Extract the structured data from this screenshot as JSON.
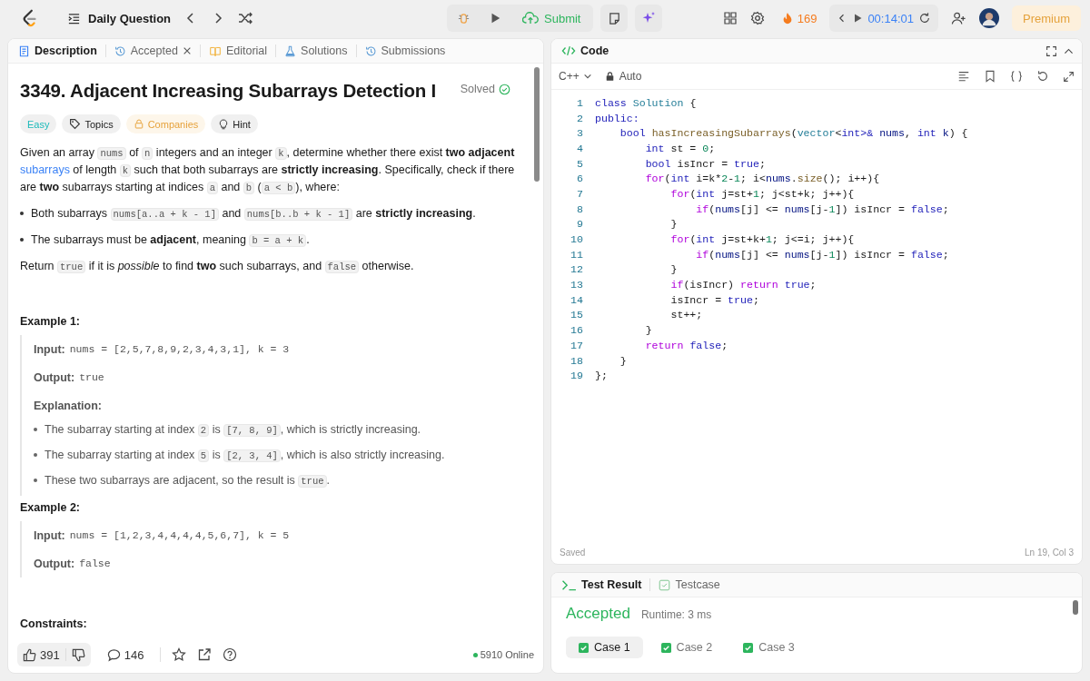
{
  "topbar": {
    "title": "Daily Question",
    "submit": "Submit",
    "streak": "169",
    "timer": "00:14:01",
    "premium": "Premium"
  },
  "left_tabs": [
    {
      "label": "Description",
      "selected": true,
      "kind": "description",
      "closable": false
    },
    {
      "label": "Accepted",
      "selected": false,
      "kind": "accepted",
      "closable": true
    },
    {
      "label": "Editorial",
      "selected": false,
      "kind": "editorial",
      "closable": false
    },
    {
      "label": "Solutions",
      "selected": false,
      "kind": "solutions",
      "closable": false
    },
    {
      "label": "Submissions",
      "selected": false,
      "kind": "submissions",
      "closable": false
    }
  ],
  "problem": {
    "title": "3349. Adjacent Increasing Subarrays Detection I",
    "status": "Solved",
    "tags": [
      {
        "label": "Easy",
        "kind": "difficulty"
      },
      {
        "label": "Topics",
        "kind": "topics"
      },
      {
        "label": "Companies",
        "kind": "companies"
      },
      {
        "label": "Hint",
        "kind": "hint"
      }
    ],
    "blocks": [
      {
        "kind": "para",
        "segments": [
          {
            "kind": "text",
            "text": "Given an array "
          },
          {
            "kind": "code",
            "text": "nums"
          },
          {
            "kind": "text",
            "text": " of "
          },
          {
            "kind": "code",
            "text": "n"
          },
          {
            "kind": "text",
            "text": " integers and an integer "
          },
          {
            "kind": "code",
            "text": "k"
          },
          {
            "kind": "text",
            "text": ", determine whether there exist **two adjacent** "
          },
          {
            "kind": "link",
            "text": "subarrays"
          },
          {
            "kind": "text",
            "text": " of length "
          },
          {
            "kind": "code",
            "text": "k"
          },
          {
            "kind": "text",
            "text": " such that both subarrays are **strictly increasing**. Specifically, check if there are **two** subarrays starting at indices "
          },
          {
            "kind": "code",
            "text": "a"
          },
          {
            "kind": "text",
            "text": " and "
          },
          {
            "kind": "code",
            "text": "b"
          },
          {
            "kind": "text",
            "text": " ("
          },
          {
            "kind": "code",
            "text": "a < b"
          },
          {
            "kind": "text",
            "text": "), where:"
          }
        ]
      },
      {
        "kind": "bullet",
        "segments": [
          {
            "kind": "text",
            "text": "Both subarrays "
          },
          {
            "kind": "code",
            "text": "nums[a..a + k - 1]"
          },
          {
            "kind": "text",
            "text": " and "
          },
          {
            "kind": "code",
            "text": "nums[b..b + k - 1]"
          },
          {
            "kind": "text",
            "text": " are **strictly increasing**."
          }
        ]
      },
      {
        "kind": "bullet",
        "segments": [
          {
            "kind": "text",
            "text": "The subarrays must be **adjacent**, meaning "
          },
          {
            "kind": "code",
            "text": "b = a + k"
          },
          {
            "kind": "text",
            "text": "."
          }
        ]
      },
      {
        "kind": "para",
        "segments": [
          {
            "kind": "text",
            "text": "Return "
          },
          {
            "kind": "code",
            "text": "true"
          },
          {
            "kind": "text",
            "text": " if it is *possible* to find **two** such subarrays, and "
          },
          {
            "kind": "code",
            "text": "false"
          },
          {
            "kind": "text",
            "text": " otherwise."
          }
        ]
      }
    ],
    "examples": [
      {
        "title": "Example 1:",
        "lines": [
          {
            "kind": "io",
            "label": "Input:",
            "value": "nums = [2,5,7,8,9,2,3,4,3,1], k = 3"
          },
          {
            "kind": "io",
            "label": "Output:",
            "value": "true"
          },
          {
            "kind": "heading",
            "label": "Explanation:"
          },
          {
            "kind": "bullet",
            "segments": [
              {
                "kind": "text",
                "text": "The subarray starting at index "
              },
              {
                "kind": "code",
                "text": "2"
              },
              {
                "kind": "text",
                "text": " is "
              },
              {
                "kind": "code",
                "text": "[7, 8, 9]"
              },
              {
                "kind": "text",
                "text": ", which is strictly increasing."
              }
            ]
          },
          {
            "kind": "bullet",
            "segments": [
              {
                "kind": "text",
                "text": "The subarray starting at index "
              },
              {
                "kind": "code",
                "text": "5"
              },
              {
                "kind": "text",
                "text": " is "
              },
              {
                "kind": "code",
                "text": "[2, 3, 4]"
              },
              {
                "kind": "text",
                "text": ", which is also strictly increasing."
              }
            ]
          },
          {
            "kind": "bullet",
            "segments": [
              {
                "kind": "text",
                "text": "These two subarrays are adjacent, so the result is "
              },
              {
                "kind": "code",
                "text": "true"
              },
              {
                "kind": "text",
                "text": "."
              }
            ]
          }
        ]
      },
      {
        "title": "Example 2:",
        "lines": [
          {
            "kind": "io",
            "label": "Input:",
            "value": "nums = [1,2,3,4,4,4,4,5,6,7], k = 5"
          },
          {
            "kind": "io",
            "label": "Output:",
            "value": "false"
          }
        ]
      }
    ],
    "constraints_heading": "Constraints:"
  },
  "footer": {
    "likes": "391",
    "comments": "146",
    "online": "5910 Online"
  },
  "code": {
    "title": "Code",
    "language": "C++",
    "mode": "Auto",
    "status": "Saved",
    "cursor": "Ln 19, Col 3",
    "lines": [
      {
        "number": "1",
        "tokens": [
          {
            "kind": "kw",
            "text": "class "
          },
          {
            "kind": "type",
            "text": "Solution"
          },
          {
            "kind": "plain",
            "text": " {"
          }
        ]
      },
      {
        "number": "2",
        "tokens": [
          {
            "kind": "kw",
            "text": "public:"
          }
        ]
      },
      {
        "number": "3",
        "tokens": [
          {
            "kind": "kw",
            "text": "    bool "
          },
          {
            "kind": "fn",
            "text": "hasIncreasingSubarrays"
          },
          {
            "kind": "plain",
            "text": "("
          },
          {
            "kind": "type",
            "text": "vector"
          },
          {
            "kind": "plain",
            "text": "<"
          },
          {
            "kind": "kw",
            "text": "int"
          },
          {
            "kind": "kw",
            "text": ">& "
          },
          {
            "kind": "var",
            "text": "nums"
          },
          {
            "kind": "plain",
            "text": ", "
          },
          {
            "kind": "kw",
            "text": "int "
          },
          {
            "kind": "var",
            "text": "k"
          },
          {
            "kind": "plain",
            "text": ") {"
          }
        ]
      },
      {
        "number": "4",
        "tokens": [
          {
            "kind": "kw",
            "text": "        int"
          },
          {
            "kind": "plain",
            "text": " st = "
          },
          {
            "kind": "num",
            "text": "0"
          },
          {
            "kind": "plain",
            "text": ";"
          }
        ]
      },
      {
        "number": "5",
        "tokens": [
          {
            "kind": "kw",
            "text": "        bool"
          },
          {
            "kind": "plain",
            "text": " isIncr = "
          },
          {
            "kind": "kw",
            "text": "true"
          },
          {
            "kind": "plain",
            "text": ";"
          }
        ]
      },
      {
        "number": "6",
        "tokens": [
          {
            "kind": "ctrl",
            "text": "        for"
          },
          {
            "kind": "plain",
            "text": "("
          },
          {
            "kind": "kw",
            "text": "int"
          },
          {
            "kind": "plain",
            "text": " i=k*"
          },
          {
            "kind": "num",
            "text": "2"
          },
          {
            "kind": "plain",
            "text": "-"
          },
          {
            "kind": "num",
            "text": "1"
          },
          {
            "kind": "plain",
            "text": "; i<"
          },
          {
            "kind": "var",
            "text": "nums"
          },
          {
            "kind": "plain",
            "text": "."
          },
          {
            "kind": "fn",
            "text": "size"
          },
          {
            "kind": "plain",
            "text": "(); i++){"
          }
        ]
      },
      {
        "number": "7",
        "tokens": [
          {
            "kind": "ctrl",
            "text": "            for"
          },
          {
            "kind": "plain",
            "text": "("
          },
          {
            "kind": "kw",
            "text": "int"
          },
          {
            "kind": "plain",
            "text": " j=st+"
          },
          {
            "kind": "num",
            "text": "1"
          },
          {
            "kind": "plain",
            "text": "; j<st+k; j++){"
          }
        ]
      },
      {
        "number": "8",
        "tokens": [
          {
            "kind": "ctrl",
            "text": "                if"
          },
          {
            "kind": "plain",
            "text": "("
          },
          {
            "kind": "var",
            "text": "nums"
          },
          {
            "kind": "plain",
            "text": "[j] <= "
          },
          {
            "kind": "var",
            "text": "nums"
          },
          {
            "kind": "plain",
            "text": "[j-"
          },
          {
            "kind": "num",
            "text": "1"
          },
          {
            "kind": "plain",
            "text": "]) isIncr = "
          },
          {
            "kind": "kw",
            "text": "false"
          },
          {
            "kind": "plain",
            "text": ";"
          }
        ]
      },
      {
        "number": "9",
        "tokens": [
          {
            "kind": "plain",
            "text": "            }"
          }
        ]
      },
      {
        "number": "10",
        "tokens": [
          {
            "kind": "ctrl",
            "text": "            for"
          },
          {
            "kind": "plain",
            "text": "("
          },
          {
            "kind": "kw",
            "text": "int"
          },
          {
            "kind": "plain",
            "text": " j=st+k+"
          },
          {
            "kind": "num",
            "text": "1"
          },
          {
            "kind": "plain",
            "text": "; j<=i; j++){"
          }
        ]
      },
      {
        "number": "11",
        "tokens": [
          {
            "kind": "ctrl",
            "text": "                if"
          },
          {
            "kind": "plain",
            "text": "("
          },
          {
            "kind": "var",
            "text": "nums"
          },
          {
            "kind": "plain",
            "text": "[j] <= "
          },
          {
            "kind": "var",
            "text": "nums"
          },
          {
            "kind": "plain",
            "text": "[j-"
          },
          {
            "kind": "num",
            "text": "1"
          },
          {
            "kind": "plain",
            "text": "]) isIncr = "
          },
          {
            "kind": "kw",
            "text": "false"
          },
          {
            "kind": "plain",
            "text": ";"
          }
        ]
      },
      {
        "number": "12",
        "tokens": [
          {
            "kind": "plain",
            "text": "            }"
          }
        ]
      },
      {
        "number": "13",
        "tokens": [
          {
            "kind": "ctrl",
            "text": "            if"
          },
          {
            "kind": "plain",
            "text": "(isIncr) "
          },
          {
            "kind": "ctrl",
            "text": "return "
          },
          {
            "kind": "kw",
            "text": "true"
          },
          {
            "kind": "plain",
            "text": ";"
          }
        ]
      },
      {
        "number": "14",
        "tokens": [
          {
            "kind": "plain",
            "text": "            isIncr = "
          },
          {
            "kind": "kw",
            "text": "true"
          },
          {
            "kind": "plain",
            "text": ";"
          }
        ]
      },
      {
        "number": "15",
        "tokens": [
          {
            "kind": "plain",
            "text": "            st++;"
          }
        ]
      },
      {
        "number": "16",
        "tokens": [
          {
            "kind": "plain",
            "text": "        }"
          }
        ]
      },
      {
        "number": "17",
        "tokens": [
          {
            "kind": "ctrl",
            "text": "        return "
          },
          {
            "kind": "kw",
            "text": "false"
          },
          {
            "kind": "plain",
            "text": ";"
          }
        ]
      },
      {
        "number": "18",
        "tokens": [
          {
            "kind": "plain",
            "text": "    }"
          }
        ]
      },
      {
        "number": "19",
        "tokens": [
          {
            "kind": "plain",
            "text": "};"
          }
        ]
      }
    ]
  },
  "test": {
    "tabs": [
      {
        "label": "Test Result",
        "selected": true,
        "kind": "result"
      },
      {
        "label": "Testcase",
        "selected": false,
        "kind": "testcase"
      }
    ],
    "verdict": "Accepted",
    "runtime": "Runtime: 3 ms",
    "cases": [
      {
        "label": "Case 1",
        "selected": true,
        "passed": true
      },
      {
        "label": "Case 2",
        "selected": false,
        "passed": true
      },
      {
        "label": "Case 3",
        "selected": false,
        "passed": true
      }
    ]
  }
}
